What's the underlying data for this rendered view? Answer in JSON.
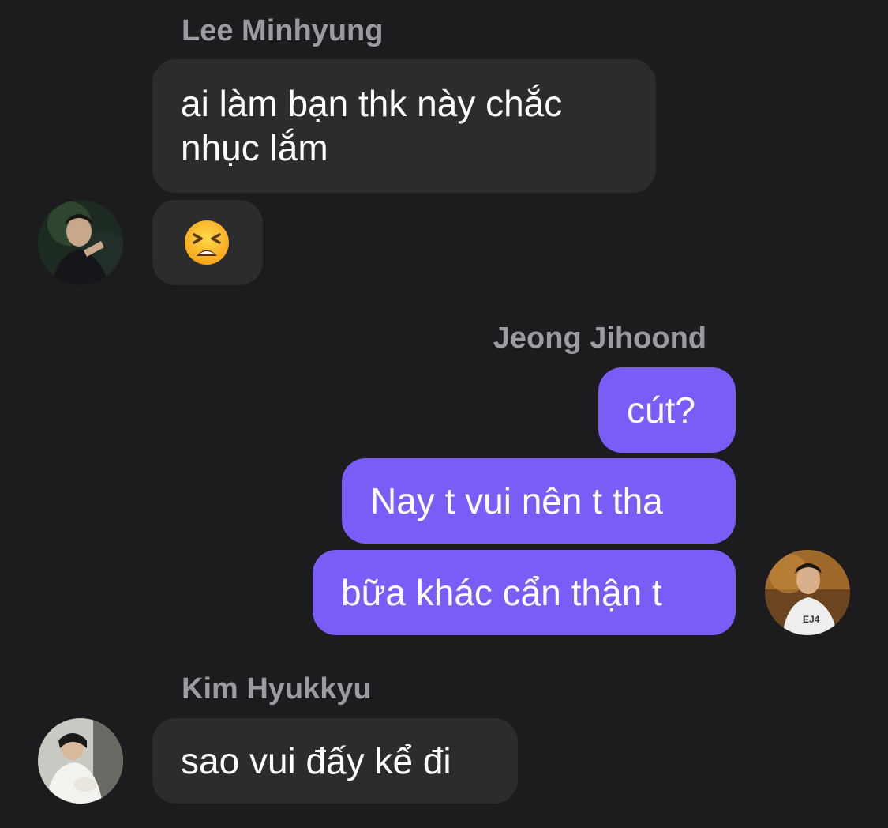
{
  "conversation": {
    "group1": {
      "sender": "Lee Minhyung",
      "messages": [
        "ai làm bạn thk này chắc\nnhục lắm"
      ],
      "reaction_emoji": "tired-face-emoji"
    },
    "group2": {
      "sender": "Jeong Jihoond",
      "messages": [
        "cút?",
        "Nay t vui nên t tha",
        "bữa khác cẩn thận t"
      ]
    },
    "group3": {
      "sender": "Kim Hyukkyu",
      "messages": [
        "sao vui đấy kể đi"
      ]
    }
  },
  "colors": {
    "background": "#1c1c1e",
    "incoming_bubble": "#2c2c2e",
    "outgoing_bubble": "#7b5cf6",
    "sender_name": "#9b9ba1",
    "message_text": "#ffffff"
  }
}
